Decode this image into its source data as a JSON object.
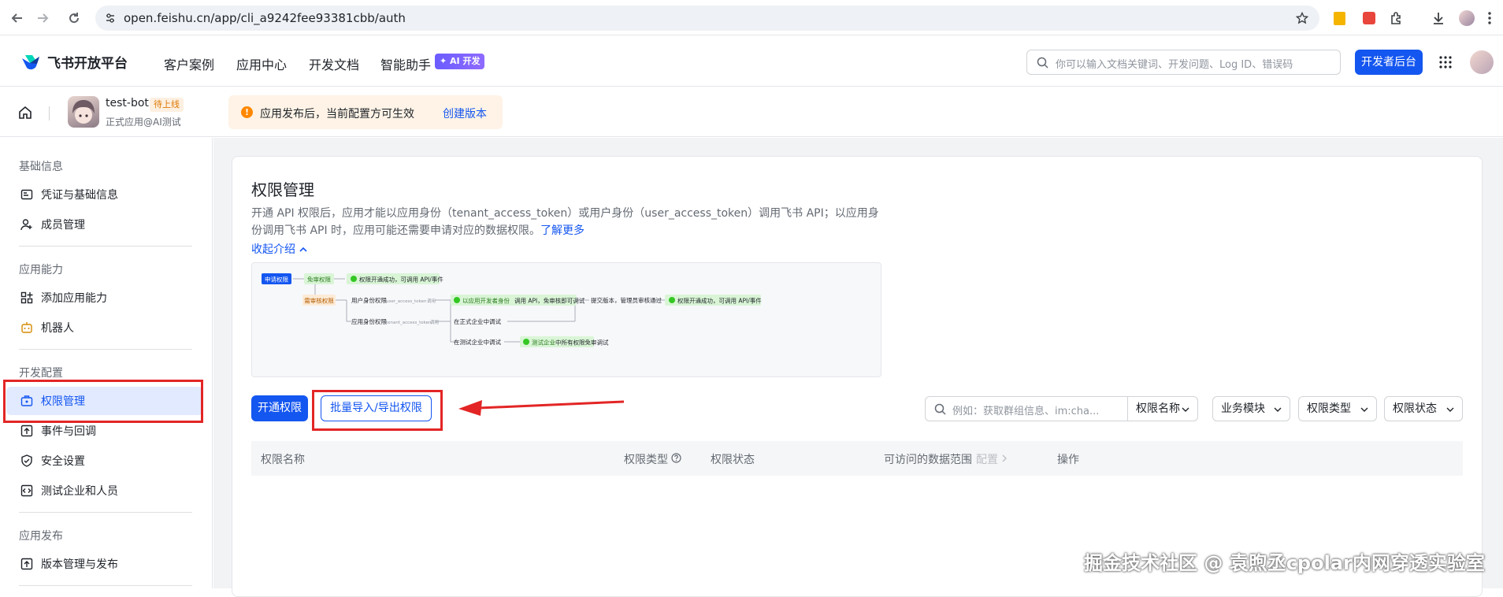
{
  "browser": {
    "url": "open.feishu.cn/app/cli_a9242fee93381cbb/auth"
  },
  "header": {
    "logo_text": "飞书开放平台",
    "nav": [
      "客户案例",
      "应用中心",
      "开发文档",
      "智能助手"
    ],
    "ai_badge": "✦ AI 开发",
    "search_placeholder": "你可以输入文档关键词、开发问题、Log ID、错误码",
    "dev_console": "开发者后台"
  },
  "app": {
    "name": "test-bot",
    "status": "待上线",
    "subtitle": "正式应用@AI测试",
    "notice_text": "应用发布后，当前配置方可生效",
    "notice_link": "创建版本"
  },
  "sidebar": {
    "groups": [
      {
        "title": "基础信息",
        "items": [
          "凭证与基础信息",
          "成员管理"
        ]
      },
      {
        "title": "应用能力",
        "items": [
          "添加应用能力",
          "机器人"
        ]
      },
      {
        "title": "开发配置",
        "items": [
          "权限管理",
          "事件与回调",
          "安全设置",
          "测试企业和人员"
        ]
      },
      {
        "title": "应用发布",
        "items": [
          "版本管理与发布"
        ]
      }
    ],
    "active": "权限管理"
  },
  "main": {
    "title": "权限管理",
    "desc": "开通 API 权限后，应用才能以应用身份（tenant_access_token）或用户身份（user_access_token）调用飞书 API；以应用身份调用飞书 API 时，应用可能还需要申请对应的数据权限。",
    "learn_more": "了解更多",
    "collapse": "收起介绍",
    "diagram": {
      "apply": "申请权限",
      "free": "免审权限",
      "ok1": "权限开通成功，可调用 API/事件",
      "need_review": "需审核权限",
      "user_identity": "用户身份权限",
      "user_token": "user_access_token",
      "call": "调用",
      "dev_identity_1": "以应用开发者身份",
      "dev_identity_2": "调用 API，免审核即可调试",
      "submit": "提交版本，管理员审核通过",
      "ok2": "权限开通成功，可调用 API/事件",
      "app_identity": "应用身份权限",
      "tenant_token": "tenant_access_token",
      "formal_debug": "在正式企业中调试",
      "test_debug": "在测试企业中调试",
      "test_free_1": "测试企业",
      "test_free_2": "中所有权限免审调试"
    },
    "btn_open": "开通权限",
    "btn_batch": "批量导入/导出权限",
    "filter_placeholder": "例如：获取群组信息、im:cha...",
    "filters": [
      "权限名称",
      "业务模块",
      "权限类型",
      "权限状态"
    ],
    "table_headers": [
      "权限名称",
      "权限类型",
      "权限状态",
      "可访问的数据范围",
      "配置",
      "操作"
    ]
  },
  "watermark": "掘金技术社区 @ 袁煦丞cpolar内网穿透实验室"
}
